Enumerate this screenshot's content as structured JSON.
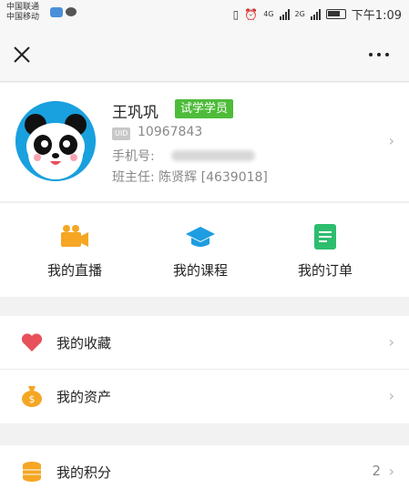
{
  "status_bar": {
    "carrier_1": "中国联通",
    "carrier_2": "中国移动",
    "net_1": "4G",
    "net_2": "2G",
    "time": "下午1:09"
  },
  "nav": {
    "close_icon": "close-icon",
    "more_icon": "more-icon"
  },
  "profile": {
    "name": "王巩巩",
    "badge": "试学学员",
    "uid_tag": "UID",
    "uid": "10967843",
    "phone_label": "手机号:",
    "teacher": "班主任: 陈贤辉 [4639018]"
  },
  "quick_actions": [
    {
      "label": "我的直播",
      "icon": "video-camera-icon",
      "color": "#f5a623"
    },
    {
      "label": "我的课程",
      "icon": "graduation-cap-icon",
      "color": "#1e9de0"
    },
    {
      "label": "我的订单",
      "icon": "document-icon",
      "color": "#2dbd6e"
    }
  ],
  "menu_group_1": [
    {
      "label": "我的收藏",
      "icon": "heart-icon",
      "color": "#e8505b"
    },
    {
      "label": "我的资产",
      "icon": "money-bag-icon",
      "color": "#f5a623"
    }
  ],
  "menu_group_2": [
    {
      "label": "我的积分",
      "icon": "coins-icon",
      "color": "#f5a623",
      "count": "2"
    }
  ]
}
